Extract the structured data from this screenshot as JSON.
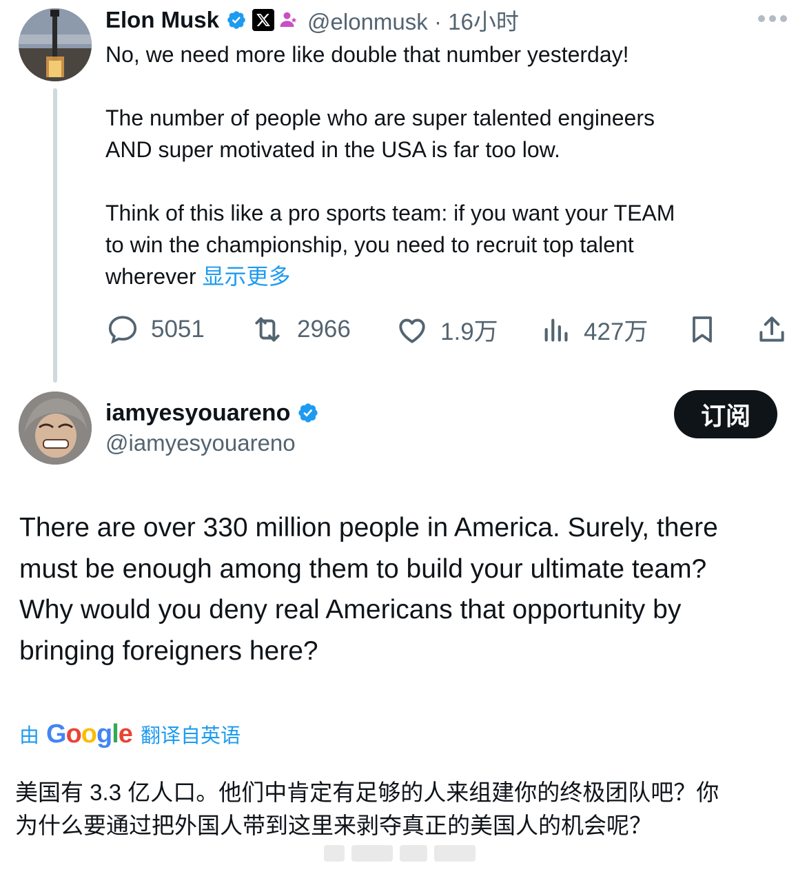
{
  "parent_tweet": {
    "author_name": "Elon Musk",
    "handle": "@elonmusk",
    "separator": "·",
    "time": "16小时",
    "lines": [
      "No, we need more like double that number yesterday!",
      "The number of people who are super talented engineers",
      "AND super motivated in the USA is far too low.",
      "Think of this like a pro sports team: if you want your TEAM",
      "to win the championship, you need to recruit top talent",
      "wherever"
    ],
    "show_more": "显示更多",
    "stats": {
      "replies": "5051",
      "reposts": "2966",
      "likes": "1.9万",
      "views": "427万"
    }
  },
  "reply_tweet": {
    "author_name": "iamyesyouareno",
    "handle": "@iamyesyouareno",
    "subscribe_label": "订阅",
    "lines": [
      "There are over 330 million people in America. Surely, there",
      "must be enough among them to build your ultimate team?",
      "Why would you deny real Americans that opportunity by",
      "bringing foreigners here?"
    ],
    "translation": {
      "by_label": "由",
      "provider": "Google",
      "from_label": "翻译自英语",
      "lines": [
        "美国有 3.3 亿人口。他们中肯定有足够的人来组建你的终极团队吧？你",
        "为什么要通过把外国人带到这里来剥夺真正的美国人的机会呢？"
      ]
    }
  },
  "colors": {
    "text": "#0f1419",
    "secondary": "#536471",
    "accent": "#1d9bf0",
    "verified": "#1d9bf0",
    "thread_line": "#cfd9de"
  },
  "icons": [
    "verified-badge-icon",
    "x-logo-icon",
    "affiliate-person-icon",
    "more-icon",
    "reply-icon",
    "repost-icon",
    "like-icon",
    "views-icon",
    "bookmark-icon",
    "share-icon"
  ]
}
